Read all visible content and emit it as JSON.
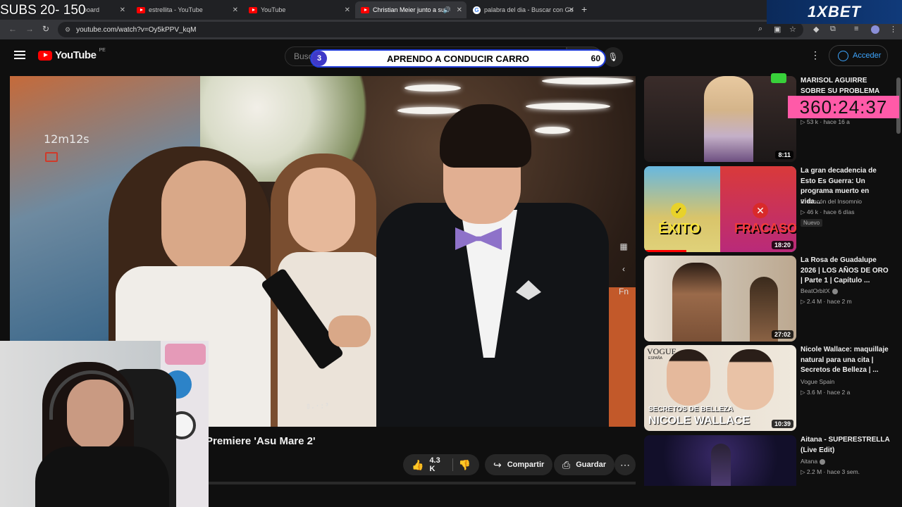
{
  "overlay": {
    "subs_label": "SUBS 20- 150",
    "bet_brand": "1XBET",
    "goal_text": "APRENDO A CONDUCIR CARRO",
    "goal_left_number": "3",
    "goal_right_number": "60",
    "timer": "360:24:37",
    "video_timer": "12m12s"
  },
  "browser": {
    "tabs": [
      {
        "label": "board"
      },
      {
        "label": "estrellita - YouTube"
      },
      {
        "label": "YouTube"
      },
      {
        "label": "Christian Meier junto a sus"
      },
      {
        "label": "palabra del dia - Buscar con Go"
      }
    ],
    "url": "youtube.com/watch?v=Oy5kPPV_kqM"
  },
  "youtube": {
    "logo_text": "YouTube",
    "country": "PE",
    "search_placeholder": "Buscar",
    "signin_label": "Acceder",
    "video_title": "Premiere 'Asu Mare 2'",
    "likes": "4.3 K",
    "share_label": "Compartir",
    "save_label": "Guardar"
  },
  "video_side": {
    "fn_label": "Fn"
  },
  "recommendations": [
    {
      "title": "MARISOL AGUIRRE SOBRE SU PROBLEMA CON",
      "channel": "",
      "views": "53 k",
      "age": "hace 16 a",
      "duration": "8:11",
      "badge": ""
    },
    {
      "title": "La gran decadencia de Esto Es Guerra: Un programa muerto en vida...",
      "channel": "El Rincón del Insomnio",
      "views": "46 k",
      "age": "hace 6 días",
      "duration": "18:20",
      "badge": "Nuevo",
      "thumb_left": "ÉXITO",
      "thumb_right": "FRACASO"
    },
    {
      "title": "La Rosa de Guadalupe 2026 | LOS AÑOS DE ORO | Parte 1 | Capítulo ...",
      "channel": "BeatOrbitX",
      "views": "2.4 M",
      "age": "hace 2 m",
      "duration": "27:02",
      "badge": ""
    },
    {
      "title": "Nicole Wallace: maquillaje natural para una cita | Secretos de Belleza | ...",
      "channel": "Vogue Spain",
      "views": "3.6 M",
      "age": "hace 2 a",
      "duration": "10:39",
      "badge": "",
      "thumb_top": "SECRETOS DE BELLEZA",
      "thumb_bottom": "NICOLE WALLACE",
      "thumb_brand": "VOGUE",
      "thumb_brand_sub": "ESPAÑA"
    },
    {
      "title": "Aitana - SUPERESTRELLA (Live Edit)",
      "channel": "Aitana",
      "views": "2.2 M",
      "age": "hace 3 sem.",
      "duration": "",
      "badge": ""
    }
  ]
}
